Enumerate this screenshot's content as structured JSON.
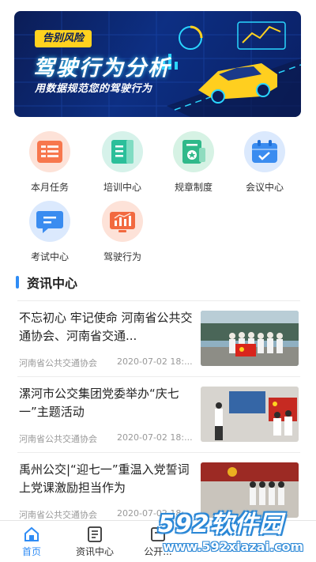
{
  "banner": {
    "tag": "告别风险",
    "title": "驾驶行为分析",
    "subtitle": "用数据规范您的驾驶行为"
  },
  "menu": {
    "items": [
      {
        "label": "本月任务",
        "icon": "task-list-icon",
        "color": "#f7774d"
      },
      {
        "label": "培训中心",
        "icon": "book-icon",
        "color": "#2bbf9a"
      },
      {
        "label": "规章制度",
        "icon": "certificate-icon",
        "color": "#30b98a"
      },
      {
        "label": "会议中心",
        "icon": "calendar-icon",
        "color": "#3a8cf0"
      },
      {
        "label": "考试中心",
        "icon": "exam-chat-icon",
        "color": "#3a8cf0"
      },
      {
        "label": "驾驶行为",
        "icon": "chart-icon",
        "color": "#f2693f"
      }
    ]
  },
  "section": {
    "title": "资讯中心"
  },
  "news": [
    {
      "title": "不忘初心 牢记使命 河南省公共交通协会、河南省交通...",
      "source": "河南省公共交通协会",
      "date": "2020-07-02 18:..."
    },
    {
      "title": "漯河市公交集团党委举办“庆七一”主题活动",
      "source": "河南省公共交通协会",
      "date": "2020-07-02 18:..."
    },
    {
      "title": "禹州公交|“迎七一”重温入党誓词 上党课激励担当作为",
      "source": "河南省公共交通协会",
      "date": "2020-07-02 18:..."
    }
  ],
  "tabbar": {
    "items": [
      {
        "label": "首页",
        "icon": "home-icon",
        "active": true
      },
      {
        "label": "资讯中心",
        "icon": "news-icon",
        "active": false
      },
      {
        "label": "公开...",
        "icon": "notice-icon",
        "active": false
      }
    ]
  },
  "watermark": {
    "brand": "592软件园",
    "url": "www.592xiazai.com"
  },
  "colors": {
    "accent": "#2f8cf5",
    "banner_bg": "#0d2f83",
    "tag_yellow": "#ffd21f"
  }
}
